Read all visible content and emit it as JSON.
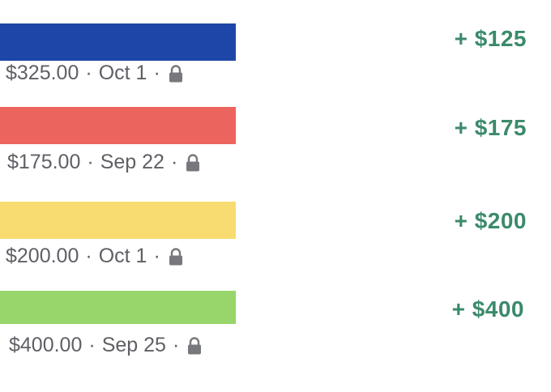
{
  "transactions": [
    {
      "color": "#1e46a8",
      "total": "$325.00",
      "date": "Oct 1",
      "change": "+ $125"
    },
    {
      "color": "#ec645e",
      "total": "$175.00",
      "date": "Sep 22",
      "change": "+ $175"
    },
    {
      "color": "#f8dc72",
      "total": "$200.00",
      "date": "Oct 1",
      "change": "+ $200"
    },
    {
      "color": "#98d56a",
      "total": "$400.00",
      "date": "Sep 25",
      "change": "+ $400"
    }
  ],
  "separator": "·",
  "lock_icon": "lock-icon"
}
